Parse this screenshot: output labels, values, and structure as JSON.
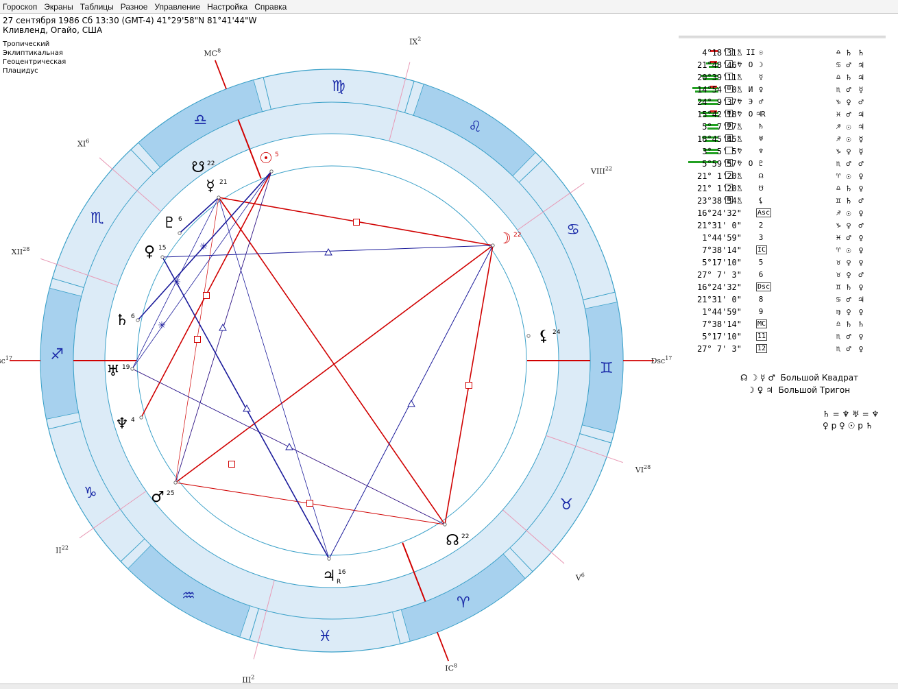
{
  "menu": [
    "Гороскоп",
    "Экраны",
    "Таблицы",
    "Разное",
    "Управление",
    "Настройка",
    "Справка"
  ],
  "info": {
    "line1": "27 сентября 1986  Сб  13:30 (GMT-4) 41°29'58\"N  81°41'44\"W",
    "line2": "Кливленд, Огайо, США"
  },
  "settings": [
    "Тропический",
    "Эклиптикальная",
    "Геоцентрическая",
    "Плацидус"
  ],
  "zodiac_signs": [
    {
      "glyph": "♐"
    },
    {
      "glyph": "♏"
    },
    {
      "glyph": "♎"
    },
    {
      "glyph": "♍"
    },
    {
      "glyph": "♌"
    },
    {
      "glyph": "♋"
    },
    {
      "glyph": "♊"
    },
    {
      "glyph": "♉"
    },
    {
      "glyph": "♈"
    },
    {
      "glyph": "♓"
    },
    {
      "glyph": "♒"
    },
    {
      "glyph": "♑"
    }
  ],
  "house_cusps": [
    {
      "name": "Asc",
      "deg": "17"
    },
    {
      "name": "II",
      "deg": "22"
    },
    {
      "name": "III",
      "deg": "2"
    },
    {
      "name": "IC",
      "deg": "8"
    },
    {
      "name": "V",
      "deg": "6"
    },
    {
      "name": "VI",
      "deg": "28"
    },
    {
      "name": "Dsc",
      "deg": "17"
    },
    {
      "name": "VIII",
      "deg": "22"
    },
    {
      "name": "IX",
      "deg": "2"
    },
    {
      "name": "MC",
      "deg": "8"
    },
    {
      "name": "XI",
      "deg": "6"
    },
    {
      "name": "XII",
      "deg": "28"
    }
  ],
  "chart_planets": [
    {
      "glyph": "☉",
      "deg": "5",
      "color": "#d00000"
    },
    {
      "glyph": "☽",
      "deg": "22",
      "color": "#d00000"
    },
    {
      "glyph": "☿",
      "deg": "21",
      "color": "#000000"
    },
    {
      "glyph": "♀",
      "deg": "15",
      "color": "#000000"
    },
    {
      "glyph": "♂",
      "deg": "25",
      "color": "#000000"
    },
    {
      "glyph": "♃",
      "deg": "16",
      "retro": "R",
      "color": "#000000"
    },
    {
      "glyph": "♄",
      "deg": "6",
      "color": "#000000"
    },
    {
      "glyph": "♅",
      "deg": "19",
      "color": "#000000"
    },
    {
      "glyph": "♆",
      "deg": "4",
      "color": "#000000"
    },
    {
      "glyph": "♇",
      "deg": "6",
      "color": "#000000"
    },
    {
      "glyph": "☊",
      "deg": "22",
      "color": "#000000"
    },
    {
      "glyph": "⚸",
      "deg": "24",
      "color": "#000000"
    },
    {
      "glyph": "☋",
      "deg": "22",
      "color": "#000000"
    }
  ],
  "table": [
    {
      "b1": "·",
      "b2": "△",
      "house": "II",
      "glyph": "☉",
      "pos": "4°18'31\"",
      "sign": "♎",
      "r1": "♄",
      "r2": "♄"
    },
    {
      "b1": "·",
      "b2": "▽",
      "house": "O",
      "glyph": "☽",
      "pos": "21°48'46\"",
      "sign": "♋",
      "r1": "♂",
      "r2": "♃"
    },
    {
      "b1": "·",
      "b2": "△",
      "house": "",
      "glyph": "☿",
      "pos": "20°39'11\"",
      "sign": "♎",
      "r1": "♄",
      "r2": "♃"
    },
    {
      "b1": "⊞",
      "b2": "△",
      "house": "И",
      "glyph": "♀",
      "pos": "14°54' 0\"",
      "sign": "♏",
      "r1": "♂",
      "r2": "☿"
    },
    {
      "b1": "·",
      "b2": "▽",
      "house": "Э",
      "glyph": "♂",
      "pos": "24° 9'37\"",
      "sign": "♑",
      "r1": "♀",
      "r2": "♂"
    },
    {
      "b1": "⊠",
      "b2": "▽",
      "house": "O",
      "glyph": "♃R",
      "pos": "15°42'18\"",
      "sign": "♓",
      "r1": "♂",
      "r2": "♃"
    },
    {
      "b1": "⊠",
      "b2": "△",
      "house": "",
      "glyph": "♄",
      "pos": "5° 7'27\"",
      "sign": "♐",
      "r1": "☉",
      "r2": "♃"
    },
    {
      "b1": "⊠",
      "b2": "△",
      "house": "",
      "glyph": "♅",
      "pos": "18°45'45\"",
      "sign": "♐",
      "r1": "☉",
      "r2": "☿"
    },
    {
      "b1": "·",
      "b2": "▽",
      "house": "",
      "glyph": "♆",
      "pos": "3° 5' 5\"",
      "sign": "♑",
      "r1": "♀",
      "r2": "☿"
    },
    {
      "b1": "⊞",
      "b2": "▽",
      "house": "O",
      "glyph": "♇",
      "pos": "5°59'57\"",
      "sign": "♏",
      "r1": "♂",
      "r2": "♂"
    },
    {
      "b1": "·",
      "b2": "△",
      "house": "",
      "glyph": "☊",
      "pos": "21° 1'20\"",
      "sign": "♈",
      "r1": "☉",
      "r2": "♀"
    },
    {
      "b1": "·",
      "b2": "△",
      "house": "",
      "glyph": "☋",
      "pos": "21° 1'20\"",
      "sign": "♎",
      "r1": "♄",
      "r2": "♀"
    },
    {
      "b1": "⊠",
      "b2": "△",
      "house": "",
      "glyph": "⚸",
      "pos": "23°38'34\"",
      "sign": "♊",
      "r1": "♄",
      "r2": "♂"
    },
    {
      "b1": "",
      "b2": "",
      "house": "",
      "glyph": "Asc",
      "pos": "16°24'32\"",
      "sign": "♐",
      "r1": "☉",
      "r2": "♀"
    },
    {
      "b1": "",
      "b2": "",
      "house": "",
      "glyph": "2",
      "pos": "21°31' 0\"",
      "sign": "♑",
      "r1": "♀",
      "r2": "♂"
    },
    {
      "b1": "",
      "b2": "",
      "house": "",
      "glyph": "3",
      "pos": "1°44'59\"",
      "sign": "♓",
      "r1": "♂",
      "r2": "♀"
    },
    {
      "b1": "",
      "b2": "",
      "house": "",
      "glyph": "IC",
      "pos": "7°38'14\"",
      "sign": "♈",
      "r1": "☉",
      "r2": "♀"
    },
    {
      "b1": "",
      "b2": "",
      "house": "",
      "glyph": "5",
      "pos": "5°17'10\"",
      "sign": "♉",
      "r1": "♀",
      "r2": "♀"
    },
    {
      "b1": "",
      "b2": "",
      "house": "",
      "glyph": "6",
      "pos": "27° 7' 3\"",
      "sign": "♉",
      "r1": "♀",
      "r2": "♂"
    },
    {
      "b1": "",
      "b2": "",
      "house": "",
      "glyph": "Dsc",
      "pos": "16°24'32\"",
      "sign": "♊",
      "r1": "♄",
      "r2": "♀"
    },
    {
      "b1": "",
      "b2": "",
      "house": "",
      "glyph": "8",
      "pos": "21°31' 0\"",
      "sign": "♋",
      "r1": "♂",
      "r2": "♃"
    },
    {
      "b1": "",
      "b2": "",
      "house": "",
      "glyph": "9",
      "pos": "1°44'59\"",
      "sign": "♍",
      "r1": "♀",
      "r2": "♀"
    },
    {
      "b1": "",
      "b2": "",
      "house": "",
      "glyph": "MC",
      "pos": "7°38'14\"",
      "sign": "♎",
      "r1": "♄",
      "r2": "♄"
    },
    {
      "b1": "",
      "b2": "",
      "house": "",
      "glyph": "11",
      "pos": "5°17'10\"",
      "sign": "♏",
      "r1": "♂",
      "r2": "♀"
    },
    {
      "b1": "",
      "b2": "",
      "house": "",
      "glyph": "12",
      "pos": "27° 7' 3\"",
      "sign": "♏",
      "r1": "♂",
      "r2": "♀"
    }
  ],
  "figures": [
    {
      "glyphs": "☊ ☽ ☿ ♂",
      "label": "Большой Квадрат"
    },
    {
      "glyphs": "☽ ♀ ♃",
      "label": "Большой Тригон"
    }
  ],
  "equations": [
    "♄ = ♆ ♅ = ♆",
    "♀ p ♀ ☉ p ♄"
  ],
  "colors": {
    "ring": "#dcebf7",
    "ring_dark": "#a7d1ee",
    "ring_line": "#3aa0c8",
    "axis": "#d00000",
    "square": "#d00000",
    "trine": "#1a1a9a",
    "sextile": "#1a1a9a"
  }
}
